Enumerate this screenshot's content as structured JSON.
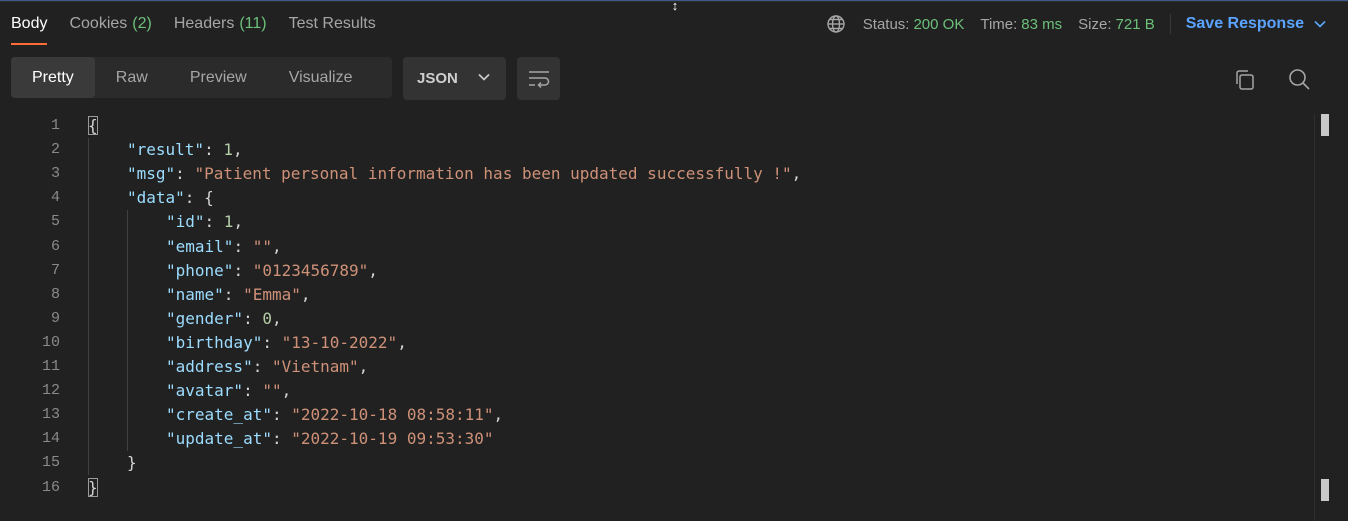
{
  "tabs": [
    {
      "label": "Body",
      "count": "",
      "active": true
    },
    {
      "label": "Cookies",
      "count": "(2)",
      "active": false
    },
    {
      "label": "Headers",
      "count": "(11)",
      "active": false
    },
    {
      "label": "Test Results",
      "count": "",
      "active": false
    }
  ],
  "status": {
    "status_label": "Status:",
    "status_value": "200 OK",
    "time_label": "Time:",
    "time_value": "83 ms",
    "size_label": "Size:",
    "size_value": "721 B",
    "save_label": "Save Response"
  },
  "view_modes": [
    "Pretty",
    "Raw",
    "Preview",
    "Visualize"
  ],
  "format": "JSON",
  "colors": {
    "accent": "#ff6c37",
    "success": "#6cc07a",
    "link": "#5aa4ff"
  },
  "icons": {
    "globe": "globe-icon",
    "wrap": "wrap-lines-icon",
    "copy": "copy-icon",
    "search": "search-icon",
    "chevron": "chevron-down-icon"
  },
  "code_lines": [
    {
      "n": "1",
      "indent": 0,
      "tokens": [
        {
          "t": "{",
          "c": "p",
          "box": true
        }
      ]
    },
    {
      "n": "2",
      "indent": 1,
      "tokens": [
        {
          "t": "\"result\"",
          "c": "k"
        },
        {
          "t": ": ",
          "c": "p"
        },
        {
          "t": "1",
          "c": "n"
        },
        {
          "t": ",",
          "c": "p"
        }
      ]
    },
    {
      "n": "3",
      "indent": 1,
      "tokens": [
        {
          "t": "\"msg\"",
          "c": "k"
        },
        {
          "t": ": ",
          "c": "p"
        },
        {
          "t": "\"Patient personal information has been updated successfully !\"",
          "c": "s"
        },
        {
          "t": ",",
          "c": "p"
        }
      ]
    },
    {
      "n": "4",
      "indent": 1,
      "tokens": [
        {
          "t": "\"data\"",
          "c": "k"
        },
        {
          "t": ": {",
          "c": "p"
        }
      ]
    },
    {
      "n": "5",
      "indent": 2,
      "tokens": [
        {
          "t": "\"id\"",
          "c": "k"
        },
        {
          "t": ": ",
          "c": "p"
        },
        {
          "t": "1",
          "c": "n"
        },
        {
          "t": ",",
          "c": "p"
        }
      ]
    },
    {
      "n": "6",
      "indent": 2,
      "tokens": [
        {
          "t": "\"email\"",
          "c": "k"
        },
        {
          "t": ": ",
          "c": "p"
        },
        {
          "t": "\"\"",
          "c": "s"
        },
        {
          "t": ",",
          "c": "p"
        }
      ]
    },
    {
      "n": "7",
      "indent": 2,
      "tokens": [
        {
          "t": "\"phone\"",
          "c": "k"
        },
        {
          "t": ": ",
          "c": "p"
        },
        {
          "t": "\"0123456789\"",
          "c": "s"
        },
        {
          "t": ",",
          "c": "p"
        }
      ]
    },
    {
      "n": "8",
      "indent": 2,
      "tokens": [
        {
          "t": "\"name\"",
          "c": "k"
        },
        {
          "t": ": ",
          "c": "p"
        },
        {
          "t": "\"Emma\"",
          "c": "s"
        },
        {
          "t": ",",
          "c": "p"
        }
      ]
    },
    {
      "n": "9",
      "indent": 2,
      "tokens": [
        {
          "t": "\"gender\"",
          "c": "k"
        },
        {
          "t": ": ",
          "c": "p"
        },
        {
          "t": "0",
          "c": "n"
        },
        {
          "t": ",",
          "c": "p"
        }
      ]
    },
    {
      "n": "10",
      "indent": 2,
      "tokens": [
        {
          "t": "\"birthday\"",
          "c": "k"
        },
        {
          "t": ": ",
          "c": "p"
        },
        {
          "t": "\"13-10-2022\"",
          "c": "s"
        },
        {
          "t": ",",
          "c": "p"
        }
      ]
    },
    {
      "n": "11",
      "indent": 2,
      "tokens": [
        {
          "t": "\"address\"",
          "c": "k"
        },
        {
          "t": ": ",
          "c": "p"
        },
        {
          "t": "\"Vietnam\"",
          "c": "s"
        },
        {
          "t": ",",
          "c": "p"
        }
      ]
    },
    {
      "n": "12",
      "indent": 2,
      "tokens": [
        {
          "t": "\"avatar\"",
          "c": "k"
        },
        {
          "t": ": ",
          "c": "p"
        },
        {
          "t": "\"\"",
          "c": "s"
        },
        {
          "t": ",",
          "c": "p"
        }
      ]
    },
    {
      "n": "13",
      "indent": 2,
      "tokens": [
        {
          "t": "\"create_at\"",
          "c": "k"
        },
        {
          "t": ": ",
          "c": "p"
        },
        {
          "t": "\"2022-10-18 08:58:11\"",
          "c": "s"
        },
        {
          "t": ",",
          "c": "p"
        }
      ]
    },
    {
      "n": "14",
      "indent": 2,
      "tokens": [
        {
          "t": "\"update_at\"",
          "c": "k"
        },
        {
          "t": ": ",
          "c": "p"
        },
        {
          "t": "\"2022-10-19 09:53:30\"",
          "c": "s"
        }
      ]
    },
    {
      "n": "15",
      "indent": 1,
      "tokens": [
        {
          "t": "}",
          "c": "p"
        }
      ]
    },
    {
      "n": "16",
      "indent": 0,
      "tokens": [
        {
          "t": "}",
          "c": "p",
          "box": true
        }
      ]
    }
  ]
}
